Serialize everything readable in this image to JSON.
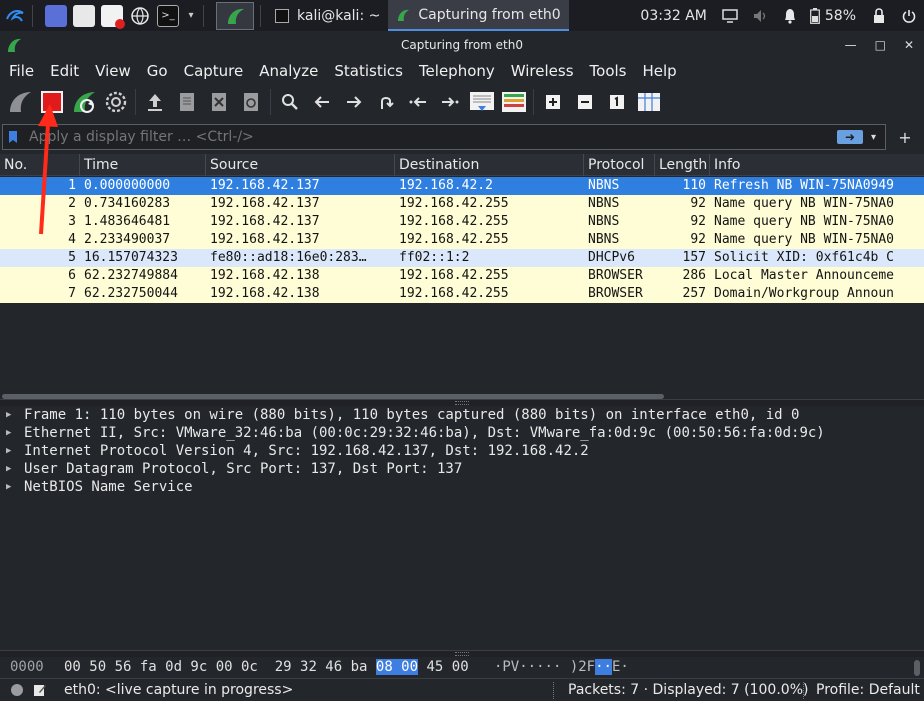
{
  "taskbar": {
    "tasks": [
      {
        "label": "kali@kali: ~",
        "active": false
      },
      {
        "label": "Capturing from eth0",
        "active": true
      }
    ],
    "clock": "03:32 AM",
    "battery": "58%"
  },
  "window": {
    "title": "Capturing from eth0"
  },
  "menu": [
    "File",
    "Edit",
    "View",
    "Go",
    "Capture",
    "Analyze",
    "Statistics",
    "Telephony",
    "Wireless",
    "Tools",
    "Help"
  ],
  "filter": {
    "placeholder": "Apply a display filter … <Ctrl-/>"
  },
  "columns": [
    "No.",
    "Time",
    "Source",
    "Destination",
    "Protocol",
    "Length",
    "Info"
  ],
  "packets": [
    {
      "no": "1",
      "time": "0.000000000",
      "src": "192.168.42.137",
      "dst": "192.168.42.2",
      "proto": "NBNS",
      "len": "110",
      "info": "Refresh NB WIN-75NA0949",
      "color": "#2f7fe0",
      "selected": true
    },
    {
      "no": "2",
      "time": "0.734160283",
      "src": "192.168.42.137",
      "dst": "192.168.42.255",
      "proto": "NBNS",
      "len": "92",
      "info": "Name query NB WIN-75NA0",
      "color": "#fefdd5",
      "selected": false
    },
    {
      "no": "3",
      "time": "1.483646481",
      "src": "192.168.42.137",
      "dst": "192.168.42.255",
      "proto": "NBNS",
      "len": "92",
      "info": "Name query NB WIN-75NA0",
      "color": "#fefdd5",
      "selected": false
    },
    {
      "no": "4",
      "time": "2.233490037",
      "src": "192.168.42.137",
      "dst": "192.168.42.255",
      "proto": "NBNS",
      "len": "92",
      "info": "Name query NB WIN-75NA0",
      "color": "#fefdd5",
      "selected": false
    },
    {
      "no": "5",
      "time": "16.157074323",
      "src": "fe80::ad18:16e0:283…",
      "dst": "ff02::1:2",
      "proto": "DHCPv6",
      "len": "157",
      "info": "Solicit XID: 0xf61c4b C",
      "color": "#dbe8fb",
      "selected": false
    },
    {
      "no": "6",
      "time": "62.232749884",
      "src": "192.168.42.138",
      "dst": "192.168.42.255",
      "proto": "BROWSER",
      "len": "286",
      "info": "Local Master Announceme",
      "color": "#fefdd5",
      "selected": false
    },
    {
      "no": "7",
      "time": "62.232750044",
      "src": "192.168.42.138",
      "dst": "192.168.42.255",
      "proto": "BROWSER",
      "len": "257",
      "info": "Domain/Workgroup Announ",
      "color": "#fefdd5",
      "selected": false
    }
  ],
  "details": [
    "Frame 1: 110 bytes on wire (880 bits), 110 bytes captured (880 bits) on interface eth0, id 0",
    "Ethernet II, Src: VMware_32:46:ba (00:0c:29:32:46:ba), Dst: VMware_fa:0d:9c (00:50:56:fa:0d:9c)",
    "Internet Protocol Version 4, Src: 192.168.42.137, Dst: 192.168.42.2",
    "User Datagram Protocol, Src Port: 137, Dst Port: 137",
    "NetBIOS Name Service"
  ],
  "bytes": {
    "offset": "0000",
    "hex_a": "00 50 56 fa 0d 9c 00 0c",
    "hex_b": "29 32 46 ba",
    "hex_hl": "08 00",
    "hex_c": "45 00",
    "ascii_a": "·PV·····",
    "ascii_b": ")2F",
    "ascii_hl": "··",
    "ascii_c": "E·"
  },
  "status": {
    "interface": "eth0: <live capture in progress>",
    "packets": "Packets: 7 · Displayed: 7 (100.0%)",
    "profile": "Profile: Default"
  },
  "colors": {
    "selected_row": "#2f7fe0",
    "udp_row": "#fefdd5",
    "ipv6_row": "#dbe8fb",
    "stop_button": "#e01b1b",
    "annotation": "#ff2a1a"
  }
}
